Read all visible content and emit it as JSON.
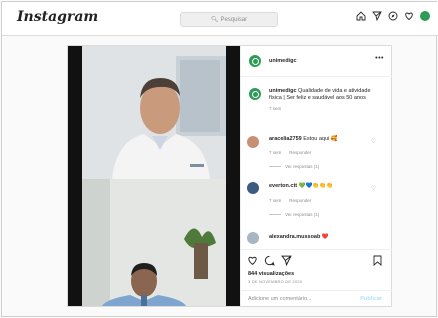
{
  "topbar": {
    "logo": "Instagram",
    "search_placeholder": "Pesquisar"
  },
  "post": {
    "author": "unimedigc",
    "caption": {
      "user": "unimedigc",
      "text": "Qualidade de vida e atividade física | Ser feliz e saudável aos 50 anos",
      "age": "7 sem"
    },
    "comments": [
      {
        "user": "aracelia2759",
        "text": "Estou aqui 🥰",
        "age": "7 sem",
        "reply": "Responder",
        "view_replies": "Ver respostas (1)"
      },
      {
        "user": "everton.ctt",
        "text": "💚💙👏👏👏",
        "age": "7 sem",
        "reply": "Responder",
        "view_replies": "Ver respostas (1)"
      },
      {
        "user": "alexandra.mussoab",
        "text": "❤️"
      }
    ],
    "views": "844 visualizações",
    "date": "3 DE NOVEMBRO DE 2020",
    "add_comment_placeholder": "Adicione um comentário...",
    "post_button": "Publicar"
  },
  "colors": {
    "brand_green": "#2e9b57",
    "link_blue": "#b2dffc"
  }
}
